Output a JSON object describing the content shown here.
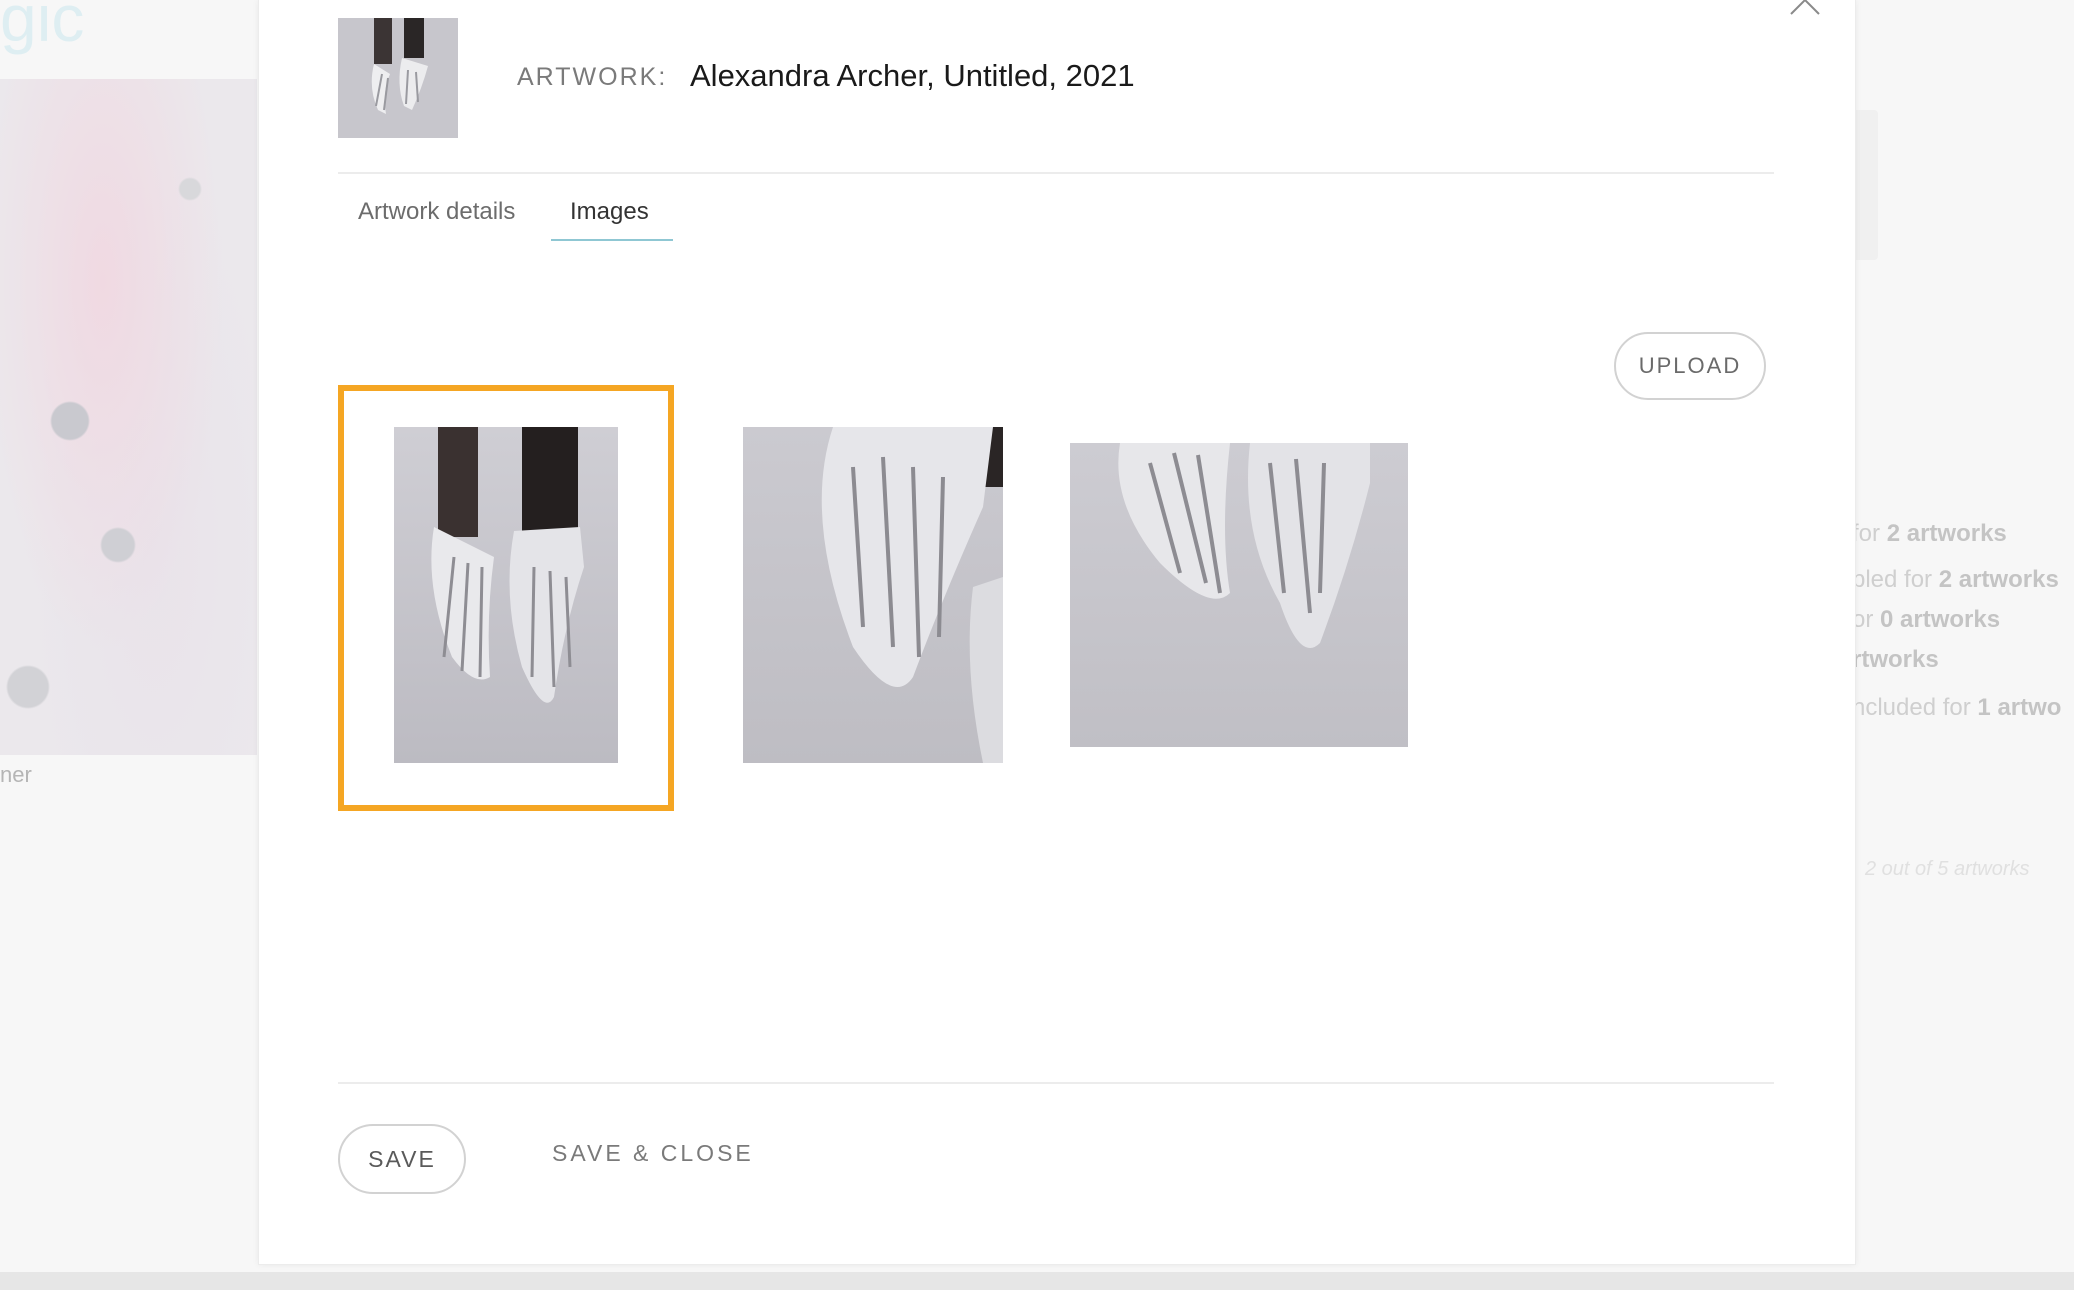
{
  "background": {
    "logo_text": "gic",
    "caption": "ner",
    "stats": [
      {
        "prefix": "for ",
        "count": "2",
        "suffix": " artworks"
      },
      {
        "prefix": "bled for ",
        "count": "2",
        "suffix": " artworks"
      },
      {
        "prefix": "or ",
        "count": "0",
        "suffix": " artworks"
      },
      {
        "prefix": "",
        "count": "",
        "suffix": "rtworks"
      },
      {
        "prefix": "ncluded for ",
        "count": "1",
        "suffix": " artwo"
      }
    ],
    "footer_note": "2 out of 5 artworks"
  },
  "modal": {
    "artwork_label": "ARTWORK:",
    "artwork_title": "Alexandra Archer, Untitled, 2021",
    "tabs": [
      {
        "label": "Artwork details",
        "active": false
      },
      {
        "label": "Images",
        "active": true
      }
    ],
    "upload_label": "UPLOAD",
    "images": [
      {
        "alt": "hands-photo-portrait",
        "selected": true
      },
      {
        "alt": "hands-photo-closeup",
        "selected": false
      },
      {
        "alt": "hands-photo-landscape",
        "selected": false
      }
    ],
    "save_label": "SAVE",
    "save_close_label": "SAVE & CLOSE"
  },
  "colors": {
    "selection_border": "#f5a623",
    "tab_underline": "#8fc7d3"
  }
}
